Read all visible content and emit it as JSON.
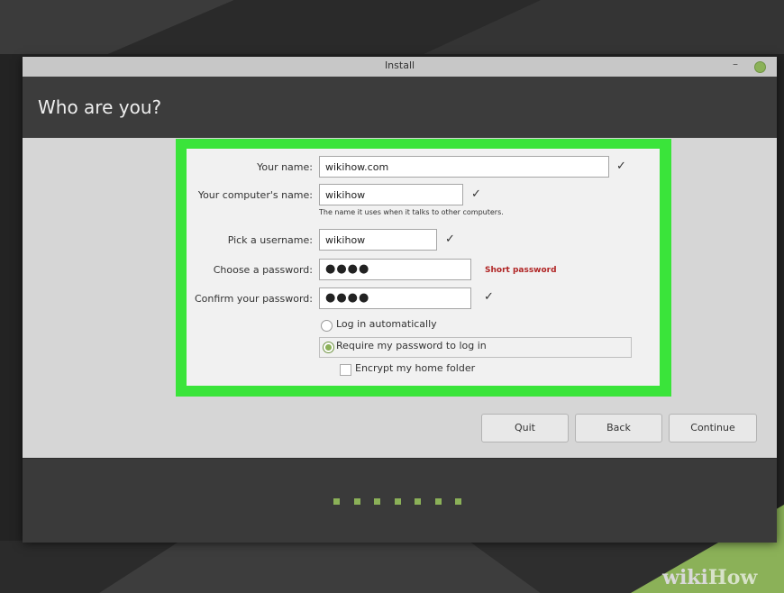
{
  "window": {
    "title": "Install",
    "minimize_glyph": "–"
  },
  "page": {
    "heading": "Who are you?"
  },
  "form": {
    "name_label": "Your name:",
    "name_value": "wikihow.com",
    "computer_label": "Your computer's name:",
    "computer_value": "wikihow",
    "computer_hint": "The name it uses when it talks to other computers.",
    "username_label": "Pick a username:",
    "username_value": "wikihow",
    "password_label": "Choose a password:",
    "password_value": "●●●●",
    "password_warning": "Short password",
    "confirm_label": "Confirm your password:",
    "confirm_value": "●●●●",
    "check_glyph": "✓",
    "login_auto_label": "Log in automatically",
    "require_password_label": "Require my password to log in",
    "require_password_selected": true,
    "encrypt_label": "Encrypt my home folder",
    "encrypt_checked": false
  },
  "buttons": {
    "quit": "Quit",
    "back": "Back",
    "continue": "Continue"
  },
  "progress": {
    "steps_total": 7,
    "icon": "step-indicator"
  },
  "watermark": {
    "wiki": "wiki",
    "how": "How"
  },
  "colors": {
    "highlight": "#3ae43a",
    "accent": "#8bb158",
    "warning": "#b02424"
  }
}
